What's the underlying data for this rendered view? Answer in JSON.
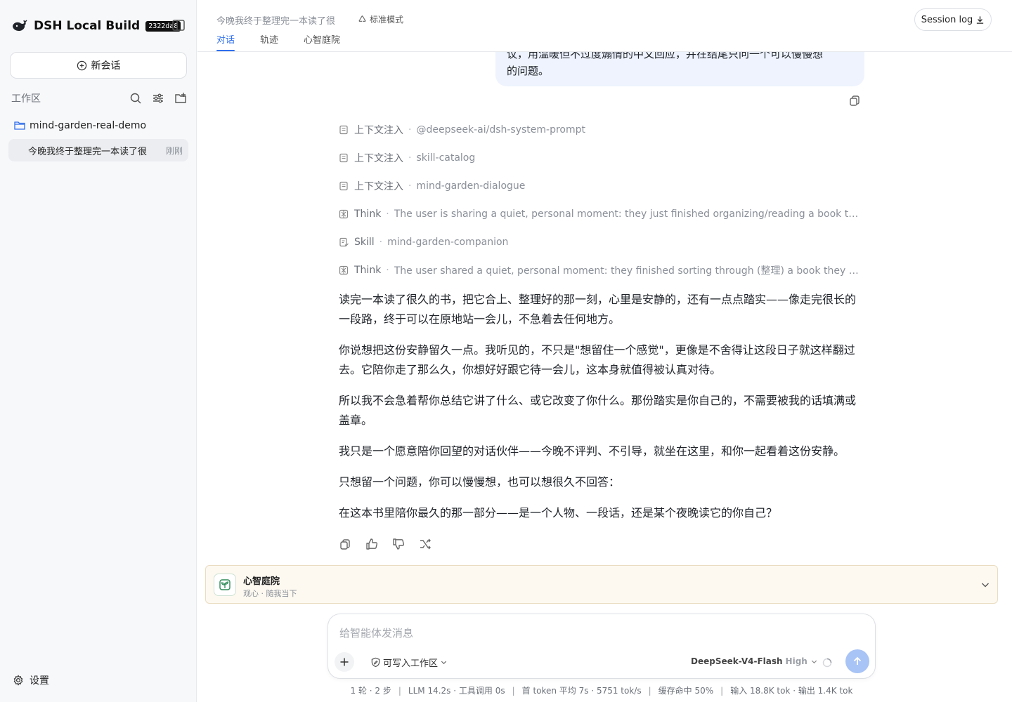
{
  "brand": {
    "title": "DSH Local Build",
    "badge": "2322da8"
  },
  "sidebar": {
    "new_chat_label": "新会话",
    "workspace_label": "工作区",
    "folder_name": "mind-garden-real-demo",
    "session": {
      "title": "今晚我终于整理完一本读了很",
      "time": "刚刚"
    },
    "settings_label": "设置"
  },
  "header": {
    "title": "今晚我终于整理完一本读了很",
    "mode": "标准模式",
    "tabs": [
      {
        "label": "对话"
      },
      {
        "label": "轨迹"
      },
      {
        "label": "心智庭院"
      }
    ],
    "session_log_label": "Session log"
  },
  "chat": {
    "user_message": {
      "line1": "议，用温暖但不过度煽情的中文回应，并在结尾只问一个可以慢慢想",
      "line2": "的问题。"
    },
    "steps": [
      {
        "kind": "上下文注入",
        "detail": "@deepseek-ai/dsh-system-prompt",
        "icon": "document-icon"
      },
      {
        "kind": "上下文注入",
        "detail": "skill-catalog",
        "icon": "document-icon"
      },
      {
        "kind": "上下文注入",
        "detail": "mind-garden-dialogue",
        "icon": "document-icon"
      },
      {
        "kind": "Think",
        "detail": "The user is sharing a quiet, personal moment: they just finished organizing/reading a book they'd been rea...",
        "icon": "brain-icon"
      },
      {
        "kind": "Skill",
        "detail": "mind-garden-companion",
        "icon": "skill-icon"
      },
      {
        "kind": "Think",
        "detail": "The user shared a quiet, personal moment: they finished sorting through (整理) a book they had been readi...",
        "icon": "brain-icon"
      }
    ],
    "answer": [
      "读完一本读了很久的书，把它合上、整理好的那一刻，心里是安静的，还有一点点踏实——像走完很长的一段路，终于可以在原地站一会儿，不急着去任何地方。",
      "你说想把这份安静留久一点。我听见的，不只是\"想留住一个感觉\"，更像是不舍得让这段日子就这样翻过去。它陪你走了那么久，你想好好跟它待一会儿，这本身就值得被认真对待。",
      "所以我不会急着帮你总结它讲了什么、或它改变了你什么。那份踏实是你自己的，不需要被我的话填满或盖章。",
      "我只是一个愿意陪你回望的对话伙伴——今晚不评判、不引导，就坐在这里，和你一起看着这份安静。",
      "只想留一个问题，你可以慢慢想，也可以想很久不回答：",
      "在这本书里陪你最久的那一部分——是一个人物、一段话，还是某个夜晚读它的你自己？"
    ]
  },
  "garden": {
    "title": "心智庭院",
    "subtitle": "观心 · 随我当下"
  },
  "composer": {
    "placeholder": "给智能体发消息",
    "permission_label": "可写入工作区",
    "model_name": "DeepSeek-V4-Flash",
    "model_level": "High"
  },
  "status": {
    "turns": "1 轮 · 2 步",
    "llm": "LLM 14.2s · 工具调用 0s",
    "token": "首 token 平均 7s · 5751 tok/s",
    "cache": "缓存命中 50%",
    "io": "输入 18.8K tok · 输出 1.4K tok"
  },
  "colors": {
    "accent": "#2f6fed",
    "send_button": "#a8c3f5",
    "user_bubble": "#eef3fd",
    "garden_bg": "#fdf9f1"
  }
}
